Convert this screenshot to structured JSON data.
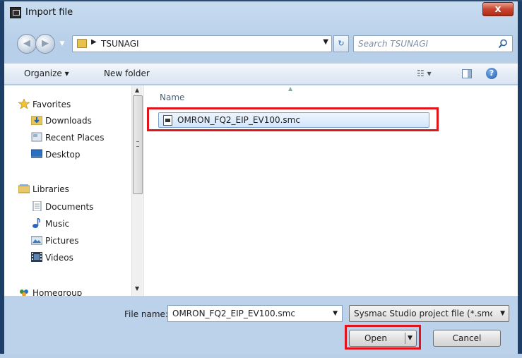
{
  "window": {
    "title": "Import file",
    "close_label": "x"
  },
  "navbar": {
    "address_path": "TSUNAGI",
    "search_placeholder": "Search TSUNAGI",
    "back_glyph": "◀",
    "forward_glyph": "▶",
    "refresh_glyph": "↻"
  },
  "toolbar": {
    "organize_label": "Organize ▾",
    "new_folder_label": "New folder",
    "views_label": "☷ ▾",
    "help_label": "?"
  },
  "sidebar": {
    "favorites": {
      "label": "Favorites",
      "items": [
        "Downloads",
        "Recent Places",
        "Desktop"
      ]
    },
    "libraries": {
      "label": "Libraries",
      "items": [
        "Documents",
        "Music",
        "Pictures",
        "Videos"
      ]
    },
    "homegroup": {
      "label": "Homegroup"
    }
  },
  "content": {
    "column_name": "Name",
    "files": [
      {
        "name": "OMRON_FQ2_EIP_EV100.smc",
        "selected": true
      }
    ]
  },
  "bottom": {
    "file_name_label": "File name:",
    "file_name_value": "OMRON_FQ2_EIP_EV100.smc",
    "file_type_value": "Sysmac Studio project file (*.smc)",
    "open_label": "Open",
    "cancel_label": "Cancel"
  },
  "icons": {
    "favorites": "star-icon",
    "downloads": "downloads-folder-icon",
    "recent": "recent-places-icon",
    "desktop": "desktop-icon",
    "libraries": "libraries-icon",
    "documents": "documents-icon",
    "music": "music-icon",
    "pictures": "pictures-icon",
    "videos": "videos-icon",
    "homegroup": "homegroup-icon"
  },
  "colors": {
    "highlight": "#e2141b",
    "selection": "#d3e6fb",
    "frame": "#1d3f67"
  }
}
